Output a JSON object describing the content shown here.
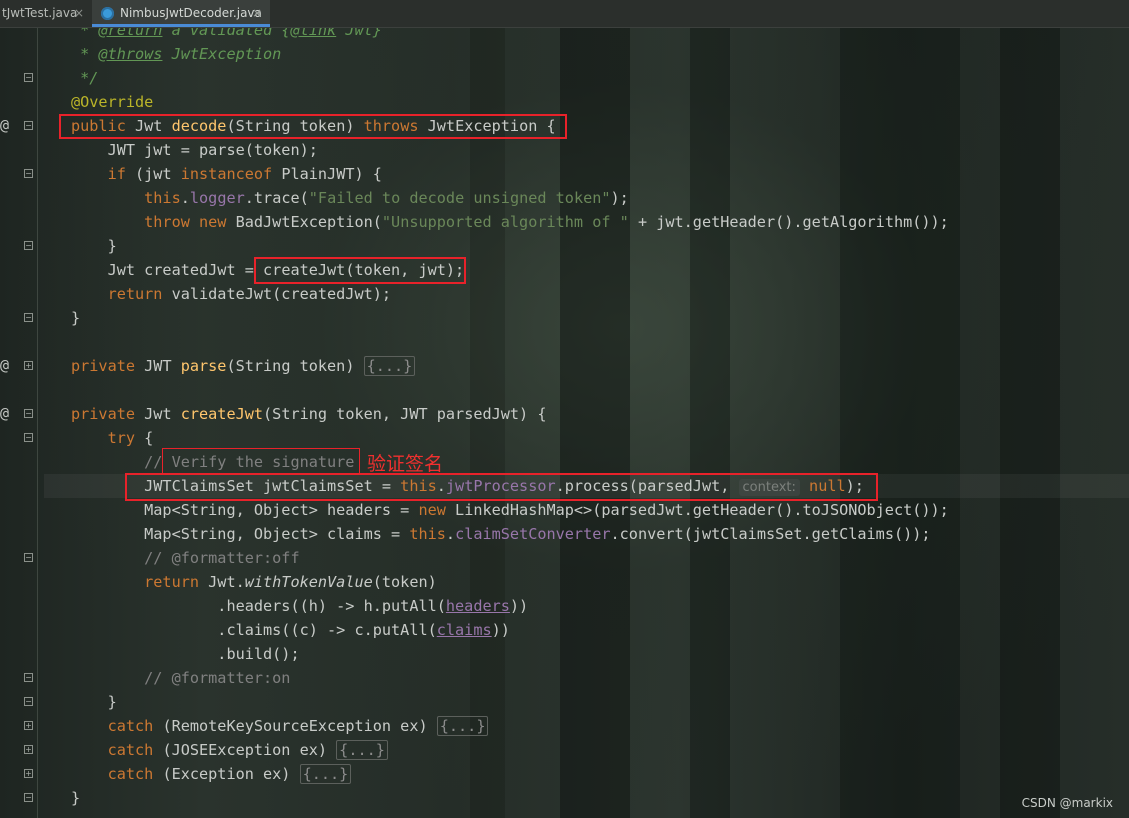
{
  "tabs": [
    {
      "label": "tJwtTest.java",
      "close": "×"
    },
    {
      "label": "NimbusJwtDecoder.java",
      "close": "×",
      "icon": "java-class-icon",
      "active": true
    }
  ],
  "gutter": {
    "at_glyph": "@",
    "fold_open": "−",
    "fold_closed": "+"
  },
  "code": {
    "l1_star": " * ",
    "l1_tag": "@return",
    "l1_text": " a validated ",
    "l1_link_open": "{",
    "l1_link": "@link",
    "l1_link_rest": " Jwt}",
    "l2_star": " * ",
    "l2_tag": "@throws",
    "l2_text": " JwtException",
    "l3": " */",
    "l4": "@Override",
    "l5_kw1": "public",
    "l5_a": " Jwt ",
    "l5_fn": "decode",
    "l5_b": "(String token) ",
    "l5_kw2": "throws",
    "l5_c": " JwtException {",
    "l6": "    JWT jwt = parse(token);",
    "l7_kw": "    if",
    "l7_a": " (jwt ",
    "l7_kw2": "instanceof",
    "l7_b": " PlainJWT) {",
    "l8_kw": "        this",
    "l8_a": ".",
    "l8_fld": "logger",
    "l8_b": ".trace(",
    "l8_str": "\"Failed to decode unsigned token\"",
    "l8_c": ");",
    "l9_kw": "        throw new",
    "l9_a": " BadJwtException(",
    "l9_str": "\"Unsupported algorithm of \"",
    "l9_b": " + jwt.getHeader().getAlgorithm());",
    "l10": "    }",
    "l11_a": "    Jwt createdJwt = ",
    "l11_b": "createJwt(token, jwt);",
    "l12_kw": "    return",
    "l12_a": " validateJwt(createdJwt);",
    "l13": "}",
    "l15_kw": "private",
    "l15_a": " JWT ",
    "l15_fn": "parse",
    "l15_b": "(String token) ",
    "l15_fold": "{...}",
    "l17_kw": "private",
    "l17_a": " Jwt ",
    "l17_fn": "createJwt",
    "l17_b": "(String token, JWT parsedJwt) {",
    "l18_kw": "    try",
    "l18_a": " {",
    "l19_a": "        //",
    "l19_b": " Verify the signature",
    "l20_a": "        JWTClaimsSet jwtClaimsSet = ",
    "l20_kw": "this",
    "l20_b": ".",
    "l20_fld": "jwtProcessor",
    "l20_c": ".process(parsedJwt, ",
    "l20_hint": "context:",
    "l20_kw2": " null",
    "l20_d": ");",
    "l21_a": "        Map<String, Object> headers = ",
    "l21_kw": "new",
    "l21_b": " LinkedHashMap<>(parsedJwt.getHeader().toJSONObject());",
    "l22_a": "        Map<String, Object> claims = ",
    "l22_kw": "this",
    "l22_b": ".",
    "l22_fld": "claimSetConverter",
    "l22_c": ".convert(jwtClaimsSet.getClaims());",
    "l23": "        // @formatter:off",
    "l24_kw": "        return",
    "l24_a": " Jwt.",
    "l24_it": "withTokenValue",
    "l24_b": "(token)",
    "l25_a": "                .headers((h) -> h.putAll(",
    "l25_ul": "headers",
    "l25_b": "))",
    "l26_a": "                .claims((c) -> c.putAll(",
    "l26_ul": "claims",
    "l26_b": "))",
    "l27": "                .build();",
    "l28": "        // @formatter:on",
    "l29": "    }",
    "l30_kw": "    catch",
    "l30_a": " (RemoteKeySourceException ex) ",
    "l30_fold": "{...}",
    "l31_kw": "    catch",
    "l31_a": " (JOSEException ex) ",
    "l31_fold": "{...}",
    "l32_kw": "    catch",
    "l32_a": " (Exception ex) ",
    "l32_fold": "{...}",
    "l33": "}"
  },
  "annotation_text": "验证签名",
  "watermark": "CSDN @markix",
  "colors": {
    "keyword": "#cc7832",
    "method": "#ffc66d",
    "string": "#6a8759",
    "field": "#9876aa",
    "annotation": "#bbb529",
    "highlight_box": "#e8222a"
  }
}
